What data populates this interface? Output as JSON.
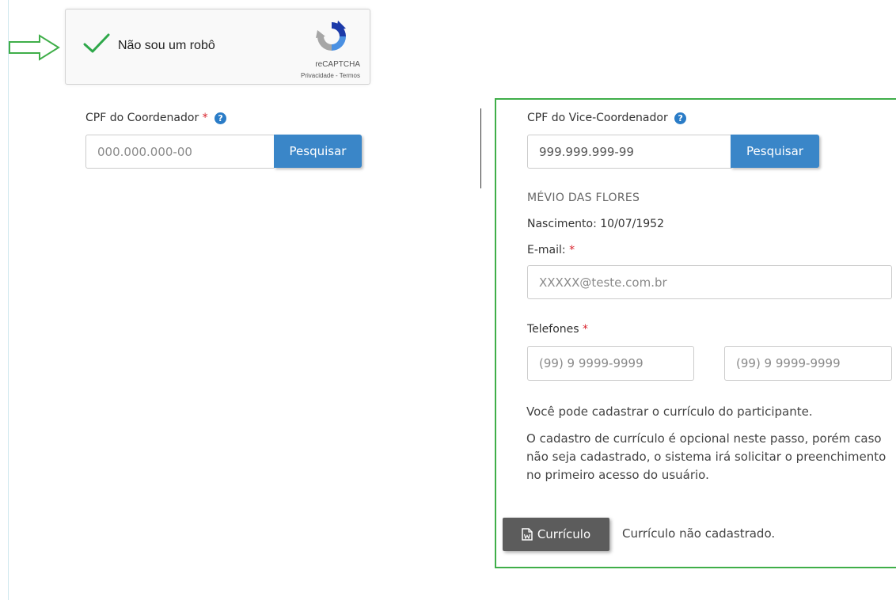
{
  "captcha": {
    "label": "Não sou um robô",
    "brand": "reCAPTCHA",
    "links": "Privacidade - Termos"
  },
  "coordenador": {
    "label": "CPF do Coordenador",
    "required_mark": "*",
    "help_glyph": "?",
    "placeholder": "000.000.000-00",
    "search_label": "Pesquisar"
  },
  "vice": {
    "label": "CPF do Vice-Coordenador",
    "help_glyph": "?",
    "cpf_value": "999.999.999-99",
    "search_label": "Pesquisar",
    "name": "MÉVIO DAS FLORES",
    "birth": "Nascimento: 10/07/1952",
    "email_label": "E-mail:",
    "email_required": "*",
    "email_placeholder": "XXXXX@teste.com.br",
    "phones_label": "Telefones",
    "phones_required": "*",
    "phone1_placeholder": "(99) 9 9999-9999",
    "phone2_placeholder": "(99) 9 9999-9999",
    "info_line": "Você pode cadastrar o currículo do participante.",
    "info_para": "O cadastro de currículo é opcional neste passo, porém caso não seja cadastrado, o sistema irá solicitar o preenchimento no primeiro acesso do usuário.",
    "curriculo_button": "Currículo",
    "curriculo_status": "Currículo não cadastrado."
  },
  "colors": {
    "accent_blue": "#3a86c8",
    "panel_border_green": "#3fae49",
    "required_red": "#d9232d",
    "check_green": "#2ea84a"
  }
}
